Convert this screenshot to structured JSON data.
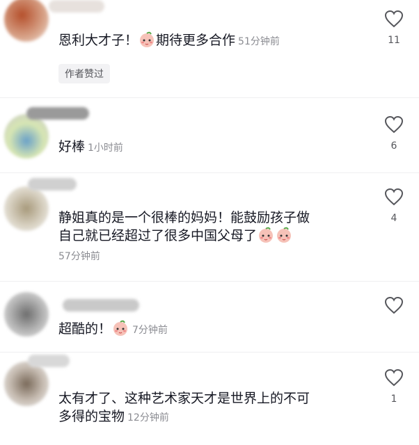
{
  "comments": [
    {
      "text": "恩利大才子！",
      "emoji_after_text": "peach-face-emoji",
      "text2": "期待更多合作",
      "time": "51分钟前",
      "likes": "11",
      "badge": "作者赞过"
    },
    {
      "text": "好棒",
      "time": "1小时前",
      "likes": "6"
    },
    {
      "line1": "静姐真的是一个很棒的妈妈！能鼓励孩子做",
      "line2": "自己就已经超过了很多中国父母了",
      "emojis": [
        "peach-face-emoji",
        "peach-face-emoji"
      ],
      "time": "57分钟前",
      "likes": "4"
    },
    {
      "text": "超酷的！",
      "emoji": "peach-face-emoji",
      "time": "7分钟前",
      "likes": ""
    },
    {
      "line1": "太有才了、这种艺术家天才是世界上的不可",
      "line2": "多得的宝物",
      "time": "12分钟前",
      "likes": "1"
    }
  ],
  "colors": {
    "text": "#161823",
    "meta": "#8a8b91",
    "divider": "#efeff1"
  }
}
